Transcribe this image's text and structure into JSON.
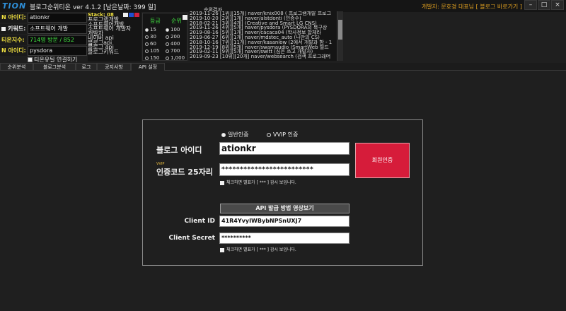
{
  "window": {
    "logo": "TION",
    "title": "블로그순위티온 ver 4.1.2 [남은날짜: 399 일]",
    "developer_link": "개발자: 문호경 대표님 [ 블로그 바로가기 ]",
    "minimize": "–",
    "maximize": "□",
    "close": "×"
  },
  "info_panel": {
    "n_id_label": "N 아이디:",
    "n_id_value": "ationkr",
    "keyword_label": "키워드:",
    "keyword_value": "소프트웨어 개발",
    "tion_index_label": "티온지수:",
    "tion_index_value": "714명 방문 / 852",
    "n_id2_label": "N 아이디:",
    "n_id2_value": "pysdora",
    "exclude_label": "티온유틸 연결하기"
  },
  "stack": {
    "header": "Stack: 08",
    "items": [
      "프로그램개발",
      "소프트웨어개발",
      "소프트웨어 개발자",
      "개발자",
      "네이버 api",
      "블로그api",
      "블로그 api",
      "블로그키워드"
    ]
  },
  "rank_panel": {
    "header_a": "등급",
    "header_b": "순위",
    "col_a": [
      "15",
      "30",
      "60",
      "105",
      "150"
    ],
    "col_b": [
      "100",
      "200",
      "400",
      "700",
      "1,000"
    ]
  },
  "log": {
    "title": "순위결과",
    "lines": [
      "2019-11-26 [1위][15개] naver/knix008 ( 프로그램개발 프로그",
      "2019-10-20 [2위][1개] naver/alstdonti (인증수)",
      "2018-02-21 [3위][4개] (Creative and Smart LG CNS)",
      "2019-11-26 [4위][5개] naver/pysdora (PYSDORA의 복구상",
      "2019-08-16 [5위][1개] naver/cacaca04 (학사정보 합체라",
      "2019-06-27 [6위][1개] naver/mdstec_auto (나만의 CS)",
      "2018-10-16 [7위][11개] naver/kasaniow (2에서 개발과 함 - 1",
      "2019-12-19 [8위][5개] naver/swamaudio (SmartWeb 빌드",
      "2019-02-11 [9위][5개] naver/switt (심은 쓰고 개발자)",
      "2019-09-23 [10위][20개] naver/websearch (검색 프로그래머"
    ]
  },
  "tabs": [
    "순위분석",
    "블로그분석",
    "로그",
    "공지사항",
    "API 설정"
  ],
  "api_settings": {
    "radio_normal": "일반인증",
    "radio_vvip": "VVIP 인증",
    "blog_id_label": "블로그 아이디",
    "blog_id_value": "ationkr",
    "vvip_tag": "VVIP",
    "auth_code_label": "인증코드 25자리",
    "auth_code_value": "*************************",
    "hint_text": "체크하면 별표가 [ *** ] 감시 보입니다.",
    "member_auth_button": "회원인증",
    "api_video_button": "API 발급 방법 영상보기",
    "client_id_label": "Client ID",
    "client_id_value": "41R4YvyIWBybNPSnUXJ7",
    "client_secret_label": "Client Secret",
    "client_secret_value": "**********",
    "hint_text2": "체크하면 별표가 [ *** ] 감시 보입니다."
  },
  "colors": {
    "accent_yellow": "#f0e040",
    "accent_green": "#40e040",
    "auth_red": "#d61c3a"
  }
}
